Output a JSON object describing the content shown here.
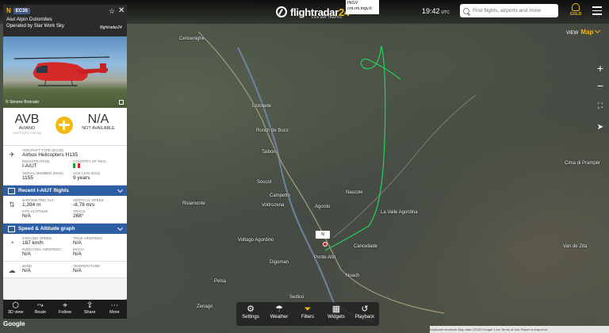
{
  "topbar": {
    "logo": "flightradar",
    "logo_num": "24",
    "logo_sub": "LIVE AIR TRAFFIC",
    "ingv_line1": "INGV",
    "ingv_line2": "cnt.rm.ingv.it",
    "time": "19:42",
    "time_zone": "UTC",
    "search_placeholder": "Find flights, airports and more",
    "gold_label": "GOLD",
    "view_label": "VIEW",
    "view_value": "Map"
  },
  "panel": {
    "flight_prefix": "N",
    "callsign": "EC35",
    "aircraft_name": "Aiut Alpin Dolomites",
    "operator": "Operated by Star Work Sky",
    "fr24_mark": "flightradar24",
    "photo_credit": "© Simone Bonnato",
    "origin_code": "AVB",
    "origin_city": "AVIANO",
    "origin_time": "CEST (UTC +02:00)",
    "dest_code": "N/A",
    "dest_city": "NOT AVAILABLE",
    "aircraft_type_label": "AIRCRAFT TYPE (EC35)",
    "aircraft_type": "Airbus Helicopters H135",
    "registration_label": "REGISTRATION",
    "registration": "I-AIUT",
    "country_label": "COUNTRY OF REG.",
    "serial_label": "SERIAL NUMBER (MSN)",
    "serial": "1155",
    "age_label": "AGE (Jan 2014)",
    "age": "9 years",
    "recent_flights": "Recent I-AIUT flights",
    "baro_label": "BAROMETRIC ALT.",
    "baro": "1,394 m",
    "vspeed_label": "VERTICAL SPEED",
    "vspeed": "-8.78 m/s",
    "gps_label": "GPS ALTITUDE",
    "gps": "N/A",
    "track_label": "TRACK",
    "track": "268°",
    "speed_graph": "Speed & Altitude graph",
    "gspeed_label": "GROUND SPEED",
    "gspeed": "187 km/h",
    "tas_label": "TRUE AIRSPEED",
    "tas": "N/A",
    "ias_label": "INDICATED AIRSPEED",
    "ias": "N/A",
    "mach_label": "MACH",
    "mach": "N/A",
    "wind_label": "WIND",
    "wind": "N/A",
    "temp_label": "TEMPERATURE",
    "temp": "N/A"
  },
  "left_toolbar": [
    {
      "icon": "cube-icon",
      "label": "3D view"
    },
    {
      "icon": "route-icon",
      "label": "Route"
    },
    {
      "icon": "follow-icon",
      "label": "Follow"
    },
    {
      "icon": "share-icon",
      "label": "Share"
    },
    {
      "icon": "more-icon",
      "label": "More"
    }
  ],
  "bottom_toolbar": [
    {
      "icon": "gear-icon",
      "label": "Settings"
    },
    {
      "icon": "weather-icon",
      "label": "Weather"
    },
    {
      "icon": "filter-icon",
      "label": "Filters"
    },
    {
      "icon": "widgets-icon",
      "label": "Widgets"
    },
    {
      "icon": "playback-icon",
      "label": "Playback"
    }
  ],
  "map": {
    "aircraft_label": "N",
    "google": "Google",
    "attribution": "Keyboard shortcuts   Map data ©2023 Google   1 km   Terms of Use   Report a map error",
    "places": [
      "Cencenighe",
      "Listolade",
      "Ronch de Bucs",
      "Taibon",
      "Soccol",
      "Campetto",
      "Voltrozena",
      "Agordo",
      "Voltago Agordino",
      "Digoman",
      "Ponte Alto",
      "La Valle Agordina",
      "Cancellade",
      "Noach",
      "Sedico",
      "Zenago",
      "Cima di Prampèr",
      "Van de Zita",
      "Pelsa",
      "Nascole",
      "Rivamonte"
    ]
  }
}
